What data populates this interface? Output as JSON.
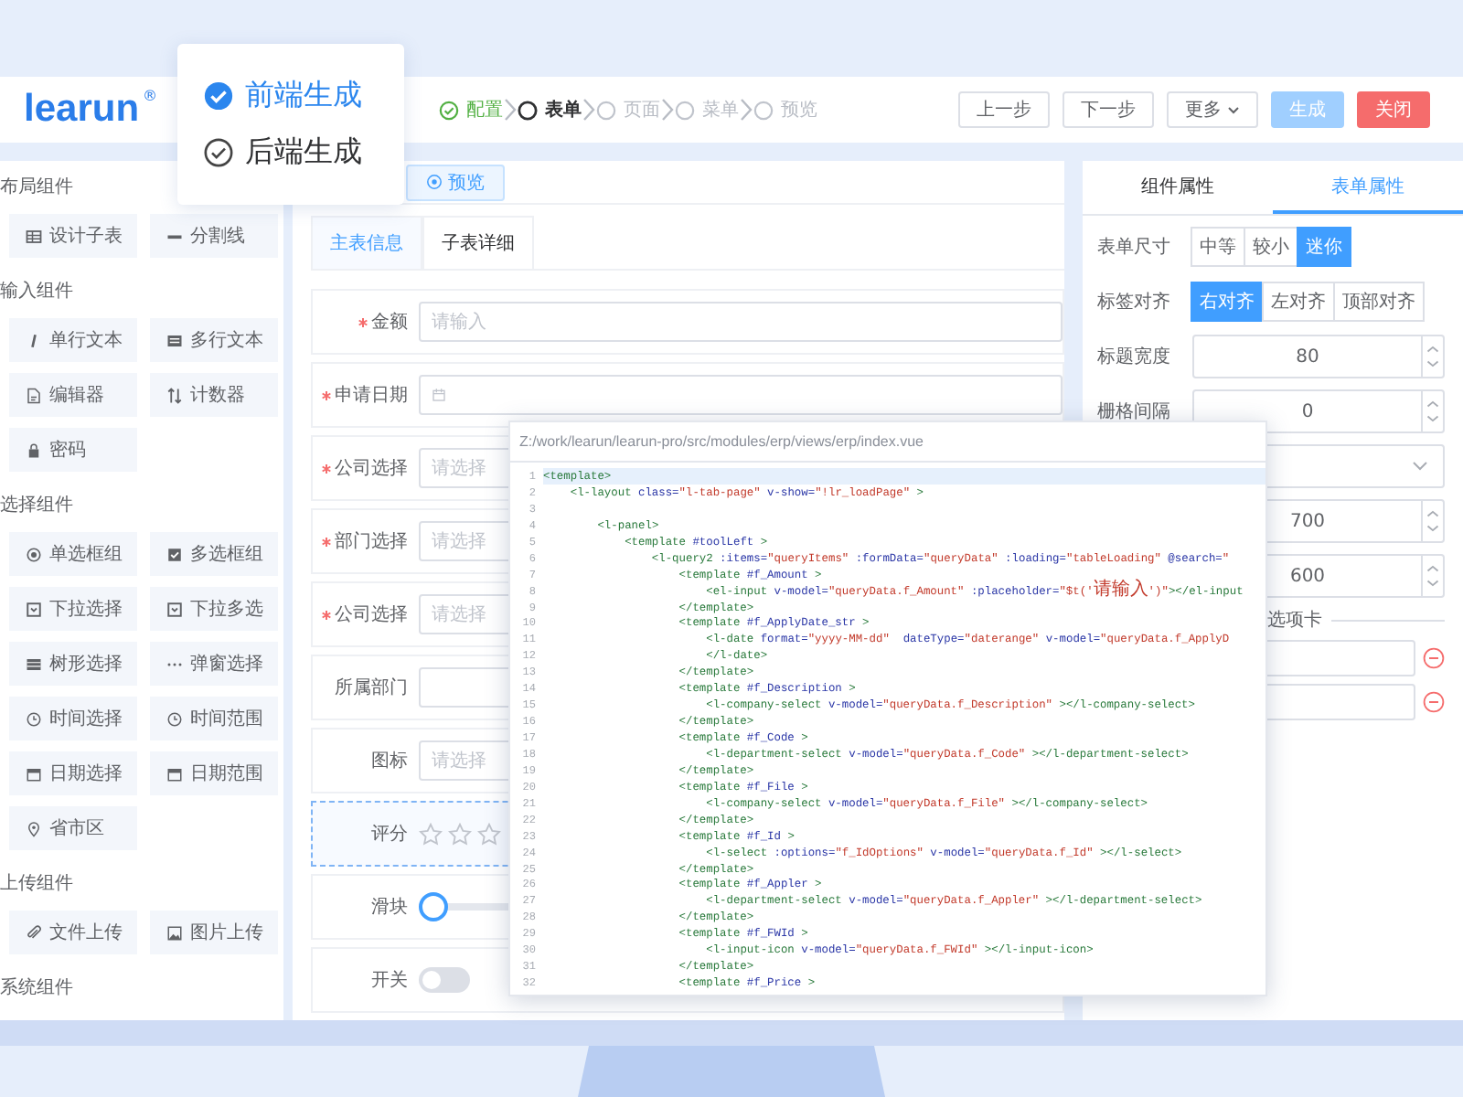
{
  "header": {
    "logo": "learun",
    "logo_mark": "®"
  },
  "generate_menu": [
    {
      "label": "前端生成",
      "selected": true
    },
    {
      "label": "后端生成",
      "selected": false
    }
  ],
  "steps": [
    {
      "label": "配置",
      "done": true,
      "selected": false
    },
    {
      "label": "表单",
      "done": false,
      "selected": true
    },
    {
      "label": "页面",
      "done": false,
      "selected": false
    },
    {
      "label": "菜单",
      "done": false,
      "selected": false
    },
    {
      "label": "预览",
      "done": false,
      "selected": false
    }
  ],
  "actions": [
    {
      "label": "上一步",
      "kind": "default",
      "disabled": false
    },
    {
      "label": "下一步",
      "kind": "default",
      "disabled": false
    },
    {
      "label": "更多",
      "kind": "dropdown",
      "disabled": false
    },
    {
      "label": "生成",
      "kind": "primary",
      "disabled": true
    },
    {
      "label": "关闭",
      "kind": "danger",
      "disabled": false
    }
  ],
  "palette": [
    {
      "title": "布局组件",
      "items": [
        {
          "label": "设计子表",
          "kind": "subtable"
        },
        {
          "label": "分割线",
          "kind": "divider"
        }
      ]
    },
    {
      "title": "输入组件",
      "items": [
        {
          "label": "单行文本",
          "kind": "text"
        },
        {
          "label": "多行文本",
          "kind": "textarea"
        },
        {
          "label": "编辑器",
          "kind": "editor"
        },
        {
          "label": "计数器",
          "kind": "counter"
        },
        {
          "label": "密码",
          "kind": "password"
        }
      ]
    },
    {
      "title": "选择组件",
      "items": [
        {
          "label": "单选框组",
          "kind": "radio"
        },
        {
          "label": "多选框组",
          "kind": "checkbox"
        },
        {
          "label": "下拉选择",
          "kind": "select"
        },
        {
          "label": "下拉多选",
          "kind": "multiselect"
        },
        {
          "label": "树形选择",
          "kind": "tree"
        },
        {
          "label": "弹窗选择",
          "kind": "popup"
        },
        {
          "label": "时间选择",
          "kind": "time"
        },
        {
          "label": "时间范围",
          "kind": "timerange"
        },
        {
          "label": "日期选择",
          "kind": "date"
        },
        {
          "label": "日期范围",
          "kind": "daterange"
        },
        {
          "label": "省市区",
          "kind": "region"
        }
      ]
    },
    {
      "title": "上传组件",
      "items": [
        {
          "label": "文件上传",
          "kind": "file"
        },
        {
          "label": "图片上传",
          "kind": "image"
        }
      ]
    },
    {
      "title": "系统组件"
    }
  ],
  "designer": {
    "preview_button": "预览",
    "tabs": [
      {
        "label": "主表信息",
        "selected": true
      },
      {
        "label": "子表详细",
        "selected": false
      }
    ],
    "fields": [
      {
        "kind": "input",
        "label": "金额",
        "required": true,
        "selected": false,
        "placeholder": "请输入"
      },
      {
        "kind": "date",
        "label": "申请日期",
        "required": true,
        "selected": false
      },
      {
        "kind": "select",
        "label": "公司选择",
        "required": true,
        "selected": false,
        "placeholder": "请选择"
      },
      {
        "kind": "select",
        "label": "部门选择",
        "required": true,
        "selected": false,
        "placeholder": "请选择"
      },
      {
        "kind": "select",
        "label": "公司选择",
        "required": true,
        "selected": false,
        "placeholder": "请选择"
      },
      {
        "kind": "input",
        "label": "所属部门",
        "required": false,
        "selected": false
      },
      {
        "kind": "select",
        "label": "图标",
        "required": false,
        "selected": false,
        "placeholder": "请选择"
      },
      {
        "kind": "rate",
        "label": "评分",
        "required": false,
        "selected": true,
        "stars": 0
      },
      {
        "kind": "slider",
        "label": "滑块",
        "required": false,
        "selected": false,
        "level": 0
      },
      {
        "kind": "switch",
        "label": "开关",
        "required": false,
        "selected": false,
        "on": false
      }
    ]
  },
  "properties": {
    "tabs": [
      {
        "label": "组件属性",
        "selected": false
      },
      {
        "label": "表单属性",
        "selected": true
      }
    ],
    "rows": [
      {
        "kind": "segmented",
        "label": "表单尺寸",
        "options": [
          {
            "label": "中等",
            "selected": false
          },
          {
            "label": "较小",
            "selected": false
          },
          {
            "label": "迷你",
            "selected": true
          }
        ]
      },
      {
        "kind": "segmented",
        "label": "标签对齐",
        "options": [
          {
            "label": "右对齐",
            "selected": true
          },
          {
            "label": "左对齐",
            "selected": false
          },
          {
            "label": "顶部对齐",
            "selected": false
          }
        ]
      },
      {
        "kind": "number",
        "label": "标题宽度",
        "value": "80"
      },
      {
        "kind": "number",
        "label": "栅格间隔",
        "value": "0"
      },
      {
        "kind": "select"
      },
      {
        "kind": "number",
        "value": "700"
      },
      {
        "kind": "number",
        "value": "600"
      },
      {
        "kind": "divider",
        "label": "选项卡"
      },
      {
        "kind": "option"
      },
      {
        "kind": "option"
      }
    ]
  },
  "code_view": {
    "path": "Z:/work/learun/learun-pro/src/modules/erp/views/erp/index.vue",
    "lines": [
      {
        "number": "1",
        "text": "<template>",
        "highlighted": true
      },
      {
        "number": "2",
        "text": "    <l-layout class=\"l-tab-page\" v-show=\"!lr_loadPage\" >",
        "highlighted": false
      },
      {
        "number": "3",
        "highlighted": false
      },
      {
        "number": "4",
        "text": "        <l-panel>",
        "highlighted": false
      },
      {
        "number": "5",
        "text": "            <template #toolLeft >",
        "highlighted": false
      },
      {
        "number": "6",
        "text": "                <l-query2 :items=\"queryItems\" :formData=\"queryData\" :loading=\"tableLoading\" @search=\"",
        "highlighted": false
      },
      {
        "number": "7",
        "text": "                    <template #f_Amount >",
        "highlighted": false
      },
      {
        "number": "8",
        "text": "                        <el-input v-model=\"queryData.f_Amount\" :placeholder=\"$t('请输入')\"></el-input",
        "highlighted": false
      },
      {
        "number": "9",
        "text": "                    </template>",
        "highlighted": false
      },
      {
        "number": "10",
        "text": "                    <template #f_ApplyDate_str >",
        "highlighted": false
      },
      {
        "number": "11",
        "text": "                        <l-date format=\"yyyy-MM-dd\"  dateType=\"daterange\" v-model=\"queryData.f_ApplyD",
        "highlighted": false
      },
      {
        "number": "12",
        "text": "                        </l-date>",
        "highlighted": false
      },
      {
        "number": "13",
        "text": "                    </template>",
        "highlighted": false
      },
      {
        "number": "14",
        "text": "                    <template #f_Description >",
        "highlighted": false
      },
      {
        "number": "15",
        "text": "                        <l-company-select v-model=\"queryData.f_Description\" ></l-company-select>",
        "highlighted": false
      },
      {
        "number": "16",
        "text": "                    </template>",
        "highlighted": false
      },
      {
        "number": "17",
        "text": "                    <template #f_Code >",
        "highlighted": false
      },
      {
        "number": "18",
        "text": "                        <l-department-select v-model=\"queryData.f_Code\" ></l-department-select>",
        "highlighted": false
      },
      {
        "number": "19",
        "text": "                    </template>",
        "highlighted": false
      },
      {
        "number": "20",
        "text": "                    <template #f_File >",
        "highlighted": false
      },
      {
        "number": "21",
        "text": "                        <l-company-select v-model=\"queryData.f_File\" ></l-company-select>",
        "highlighted": false
      },
      {
        "number": "22",
        "text": "                    </template>",
        "highlighted": false
      },
      {
        "number": "23",
        "text": "                    <template #f_Id >",
        "highlighted": false
      },
      {
        "number": "24",
        "text": "                        <l-select :options=\"f_IdOptions\" v-model=\"queryData.f_Id\" ></l-select>",
        "highlighted": false
      },
      {
        "number": "25",
        "text": "                    </template>",
        "highlighted": false
      },
      {
        "number": "26",
        "text": "                    <template #f_Appler >",
        "highlighted": false
      },
      {
        "number": "27",
        "text": "                        <l-department-select v-model=\"queryData.f_Appler\" ></l-department-select>",
        "highlighted": false
      },
      {
        "number": "28",
        "text": "                    </template>",
        "highlighted": false
      },
      {
        "number": "29",
        "text": "                    <template #f_FWId >",
        "highlighted": false
      },
      {
        "number": "30",
        "text": "                        <l-input-icon v-model=\"queryData.f_FWId\" ></l-input-icon>",
        "highlighted": false
      },
      {
        "number": "31",
        "text": "                    </template>",
        "highlighted": false
      },
      {
        "number": "32",
        "text": "                    <template #f_Price >",
        "highlighted": false
      }
    ]
  }
}
